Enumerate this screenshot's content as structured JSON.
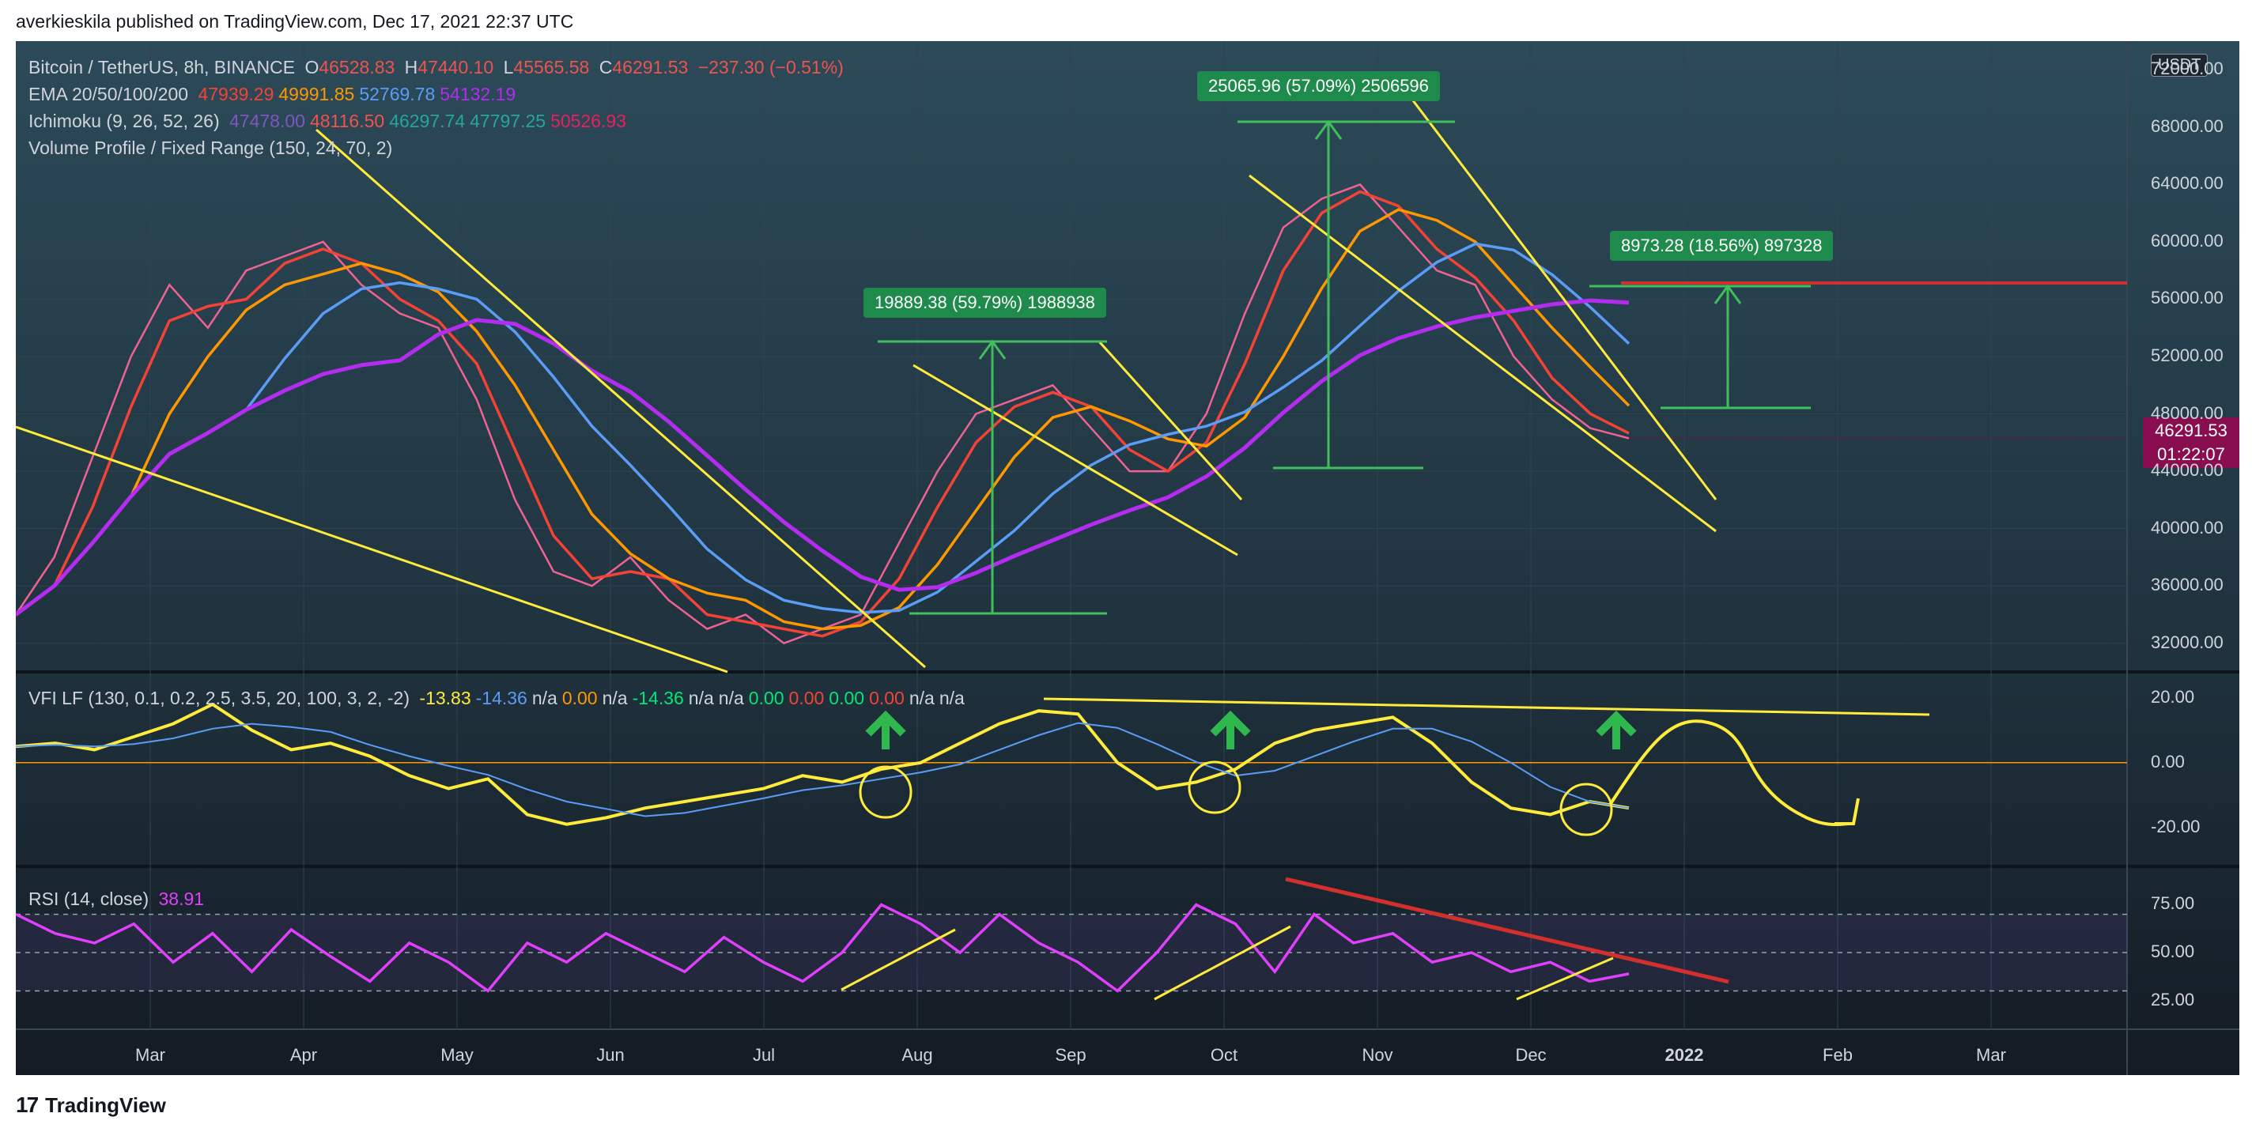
{
  "header": {
    "text": "averkieskila published on TradingView.com, Dec 17, 2021 22:37 UTC"
  },
  "footer": {
    "brand": "TradingView",
    "logo": "17"
  },
  "chart_data": {
    "type": "line",
    "title": "Bitcoin / TetherUS, 8h, BINANCE",
    "ohlc": {
      "o_label": "O",
      "o": "46528.83",
      "h_label": "H",
      "h": "47440.10",
      "l_label": "L",
      "l": "45565.58",
      "c_label": "C",
      "c": "46291.53",
      "change": "−237.30 (−0.51%)"
    },
    "currency": "USDT",
    "last_price": "46291.53",
    "countdown": "01:22:07",
    "indicators": {
      "ema": {
        "label": "EMA 20/50/100/200",
        "values": [
          "47939.29",
          "49991.85",
          "52769.78",
          "54132.19"
        ],
        "colors": [
          "#f44336",
          "#ff9800",
          "#5b9cf6",
          "#b42cf0"
        ]
      },
      "ichimoku": {
        "label": "Ichimoku (9, 26, 52, 26)",
        "values": [
          "47478.00",
          "48116.50",
          "46297.74",
          "47797.25",
          "50526.93"
        ],
        "colors": [
          "#7e57c2",
          "#ef5350",
          "#26a69a",
          "#26a69a",
          "#e91e63"
        ]
      },
      "volume_profile": {
        "label": "Volume Profile / Fixed Range (150, 24, 70, 2)"
      },
      "vfi": {
        "label": "VFI LF (130, 0.1, 0.2, 2.5, 3.5, 20, 100, 3, 2, -2)",
        "values": [
          "-13.83",
          "-14.36",
          "n/a",
          "0.00",
          "n/a",
          "-14.36",
          "n/a",
          "n/a",
          "0.00",
          "0.00",
          "0.00",
          "0.00",
          "n/a",
          "n/a"
        ],
        "colors": [
          "#ffeb3b",
          "#5b9cf6",
          "#d1d4dc",
          "#ff9800",
          "#d1d4dc",
          "#00e676",
          "#d1d4dc",
          "#d1d4dc",
          "#00e676",
          "#f44336",
          "#00e676",
          "#f44336",
          "#d1d4dc",
          "#d1d4dc"
        ],
        "yticks": [
          "20.00",
          "0.00",
          "-20.00"
        ]
      },
      "rsi": {
        "label": "RSI (14, close)",
        "value": "38.91",
        "yticks": [
          "75.00",
          "50.00",
          "25.00"
        ]
      }
    },
    "price_yticks": [
      "72000.00",
      "68000.00",
      "64000.00",
      "60000.00",
      "56000.00",
      "52000.00",
      "48000.00",
      "44000.00",
      "40000.00",
      "36000.00",
      "32000.00"
    ],
    "x_labels": [
      "Mar",
      "Apr",
      "May",
      "Jun",
      "Jul",
      "Aug",
      "Sep",
      "Oct",
      "Nov",
      "Dec",
      "2022",
      "Feb",
      "Mar"
    ],
    "annotations": [
      {
        "text": "19889.38 (59.79%) 1988938"
      },
      {
        "text": "25065.96 (57.09%) 2506596"
      },
      {
        "text": "8973.28 (18.56%) 897328"
      }
    ],
    "series": [
      {
        "values": [
          34000,
          38000,
          45000,
          52000,
          57000,
          54000,
          58000,
          59000,
          60000,
          57000,
          55000,
          54000,
          49000,
          42000,
          37000,
          36000,
          38000,
          35000,
          33000,
          34000,
          32000,
          33000,
          34000,
          39000,
          44000,
          48000,
          49000,
          50000,
          47000,
          44000,
          44000,
          48000,
          55000,
          61000,
          63000,
          64000,
          61000,
          58000,
          57000,
          52000,
          49000,
          47000,
          46291
        ]
      }
    ],
    "vfi_series": [
      {
        "values": [
          5,
          6,
          4,
          8,
          12,
          18,
          10,
          4,
          6,
          2,
          -4,
          -8,
          -5,
          -16,
          -19,
          -17,
          -14,
          -12,
          -10,
          -8,
          -4,
          -6,
          -2,
          0,
          6,
          12,
          16,
          15,
          0,
          -8,
          -6,
          -2,
          6,
          10,
          12,
          14,
          6,
          -6,
          -14,
          -16,
          -12,
          -14
        ]
      }
    ],
    "rsi_series": [
      {
        "values": [
          70,
          60,
          55,
          65,
          45,
          60,
          40,
          62,
          48,
          35,
          55,
          45,
          30,
          55,
          45,
          60,
          50,
          40,
          58,
          45,
          35,
          50,
          75,
          65,
          50,
          70,
          55,
          45,
          30,
          50,
          75,
          65,
          40,
          70,
          55,
          60,
          45,
          50,
          40,
          45,
          35,
          38.91
        ]
      }
    ]
  }
}
